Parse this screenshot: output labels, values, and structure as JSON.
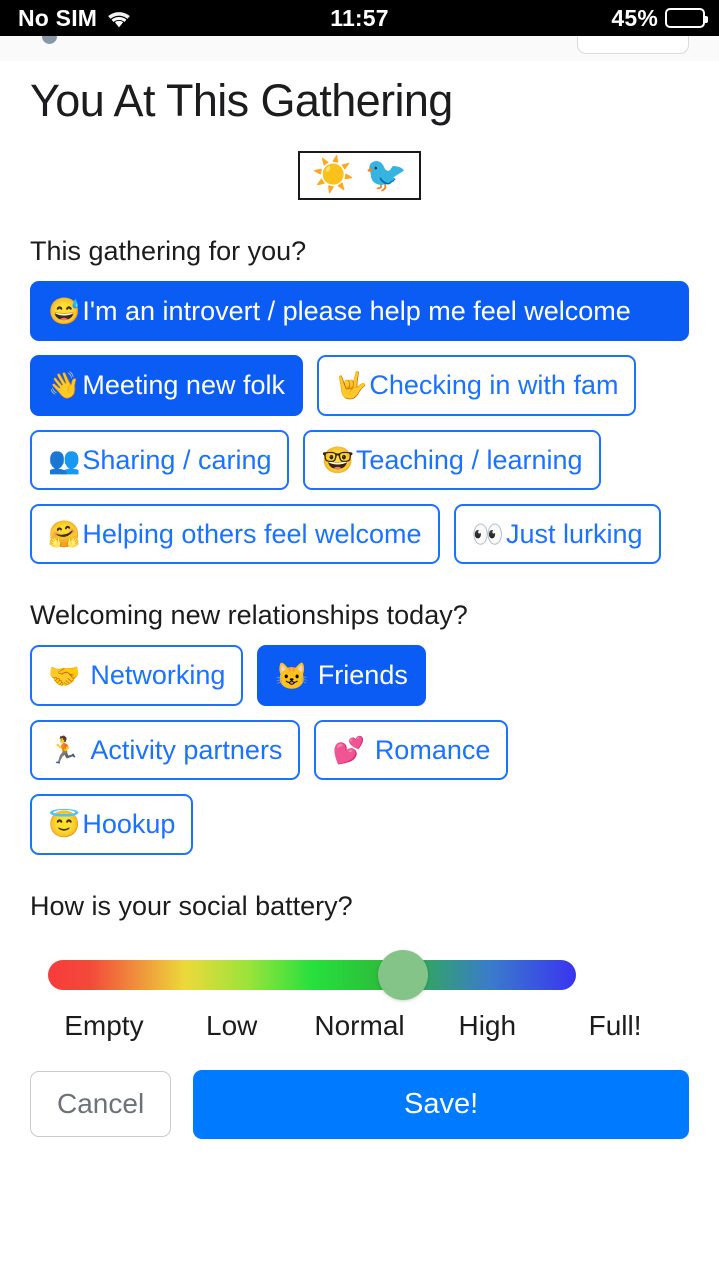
{
  "status_bar": {
    "carrier": "No SIM",
    "wifi_icon": "wifi-icon",
    "time": "11:57",
    "battery_percent": "45%",
    "battery_level": 45
  },
  "header": {
    "title": "You At This Gathering",
    "badge_emojis": [
      "☀️",
      "🐦"
    ]
  },
  "sections": [
    {
      "question": "This gathering for you?",
      "rows": [
        [
          {
            "emoji": "😅",
            "label": "I'm an introvert / please help me feel welcome",
            "selected": true,
            "wide": true
          }
        ],
        [
          {
            "emoji": "👋",
            "label": "Meeting new folk",
            "selected": true
          },
          {
            "emoji": "🤟",
            "label": "Checking in with fam",
            "selected": false
          }
        ],
        [
          {
            "emoji": "👥",
            "label": "Sharing / caring",
            "selected": false
          },
          {
            "emoji": "🤓",
            "label": "Teaching / learning",
            "selected": false
          }
        ],
        [
          {
            "emoji": "🤗",
            "label": "Helping others feel welcome",
            "selected": false
          },
          {
            "emoji": "👀",
            "label": "Just lurking",
            "selected": false
          }
        ]
      ]
    },
    {
      "question": "Welcoming new relationships today?",
      "rows": [
        [
          {
            "emoji": "🤝",
            "label": "Networking",
            "selected": false
          },
          {
            "emoji": "😺",
            "label": "Friends",
            "selected": true,
            "spaced": true
          }
        ],
        [
          {
            "emoji": "🏃",
            "label": "Activity partners",
            "selected": false
          },
          {
            "emoji": "💕",
            "label": "Romance",
            "selected": false
          }
        ],
        [
          {
            "emoji": "😇",
            "label": "Hookup",
            "selected": false
          }
        ]
      ]
    }
  ],
  "battery_slider": {
    "question": "How is your social battery?",
    "labels": [
      "Empty",
      "Low",
      "Normal",
      "High",
      "Full!"
    ],
    "value_label": "Normal",
    "value_percent": 57,
    "gradient_from": "#f83b3b",
    "gradient_to": "#3a34f0",
    "thumb_color": "#84c489"
  },
  "actions": {
    "cancel_label": "Cancel",
    "save_label": "Save!",
    "save_color": "#007bff"
  },
  "theme": {
    "accent_blue": "#0a5cf5",
    "chip_border_blue": "#1a73ff",
    "text_dark": "#1c1c1e"
  }
}
